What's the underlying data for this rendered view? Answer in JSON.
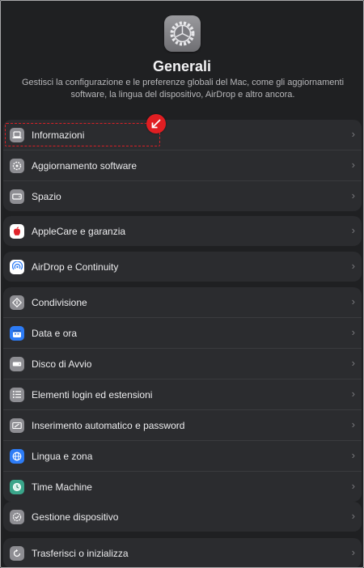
{
  "header": {
    "title": "Generali",
    "subtitle": "Gestisci la configurazione e le preferenze globali del Mac, come gli aggiornamenti software, la lingua del dispositivo, AirDrop e altro ancora."
  },
  "groups": [
    {
      "items": [
        {
          "label": "Informazioni",
          "icon": "laptop-icon",
          "color": "#8e8e93"
        },
        {
          "label": "Aggiornamento software",
          "icon": "gear-update-icon",
          "color": "#8e8e93"
        },
        {
          "label": "Spazio",
          "icon": "drive-icon",
          "color": "#8e8e93"
        }
      ]
    },
    {
      "items": [
        {
          "label": "AppleCare e garanzia",
          "icon": "apple-icon",
          "color": "#ffffff"
        }
      ]
    },
    {
      "items": [
        {
          "label": "AirDrop e Continuity",
          "icon": "airdrop-icon",
          "color": "#ffffff"
        }
      ]
    },
    {
      "items": [
        {
          "label": "Condivisione",
          "icon": "sharing-icon",
          "color": "#8e8e93"
        },
        {
          "label": "Data e ora",
          "icon": "calendar-icon",
          "color": "#2d7cf6"
        },
        {
          "label": "Disco di Avvio",
          "icon": "disk-icon",
          "color": "#8e8e93"
        },
        {
          "label": "Elementi login ed estensioni",
          "icon": "list-icon",
          "color": "#8e8e93"
        },
        {
          "label": "Inserimento automatico e password",
          "icon": "password-icon",
          "color": "#8e8e93"
        },
        {
          "label": "Lingua e zona",
          "icon": "globe-icon",
          "color": "#2d7cf6"
        },
        {
          "label": "Time Machine",
          "icon": "time-machine-icon",
          "color": "#3aa58a"
        }
      ]
    },
    {
      "items": [
        {
          "label": "Gestione dispositivo",
          "icon": "device-management-icon",
          "color": "#8e8e93"
        }
      ]
    },
    {
      "items": [
        {
          "label": "Trasferisci o inizializza",
          "icon": "reset-icon",
          "color": "#8e8e93"
        }
      ]
    }
  ],
  "colors": {
    "annotation": "#e01e22",
    "background": "#1f2022",
    "panel": "#2b2c2f"
  }
}
